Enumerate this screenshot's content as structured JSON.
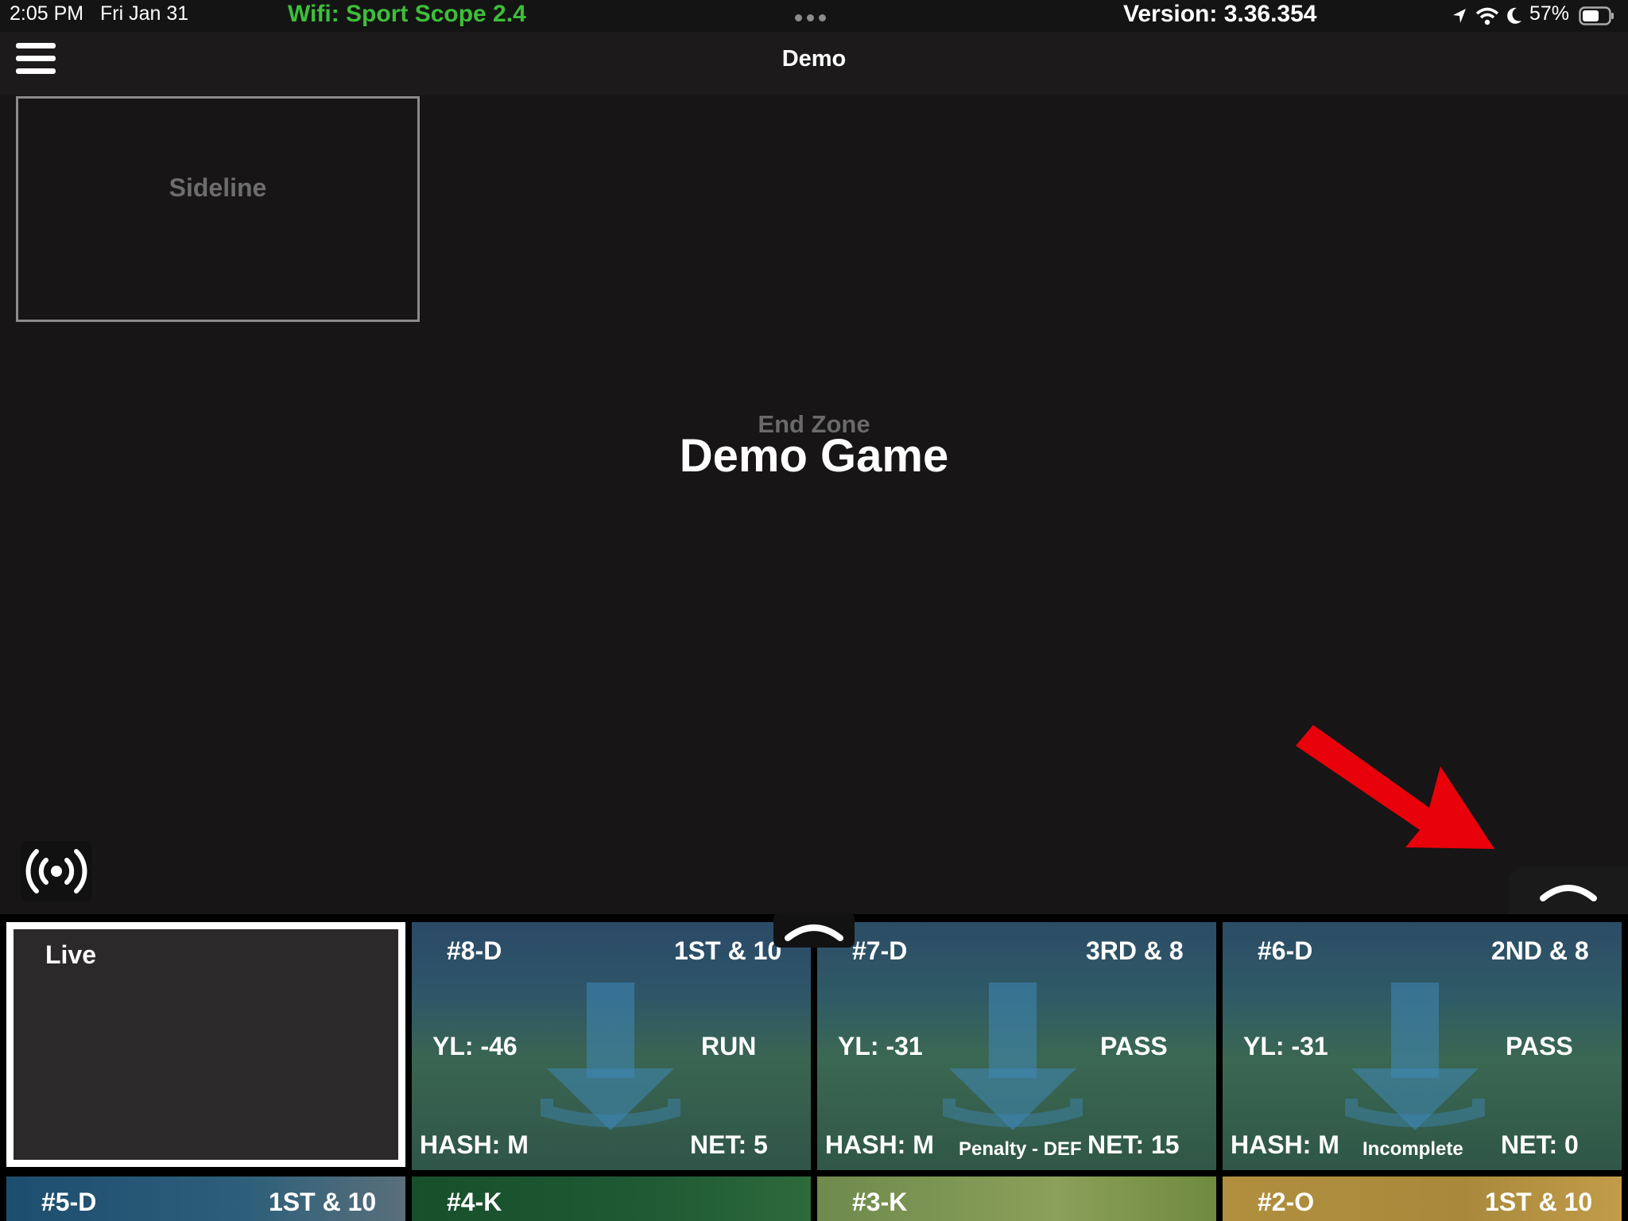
{
  "status_bar": {
    "time": "2:05 PM",
    "date": "Fri Jan 31",
    "wifi_label": "Wifi: Sport Scope 2.4",
    "version": "Version: 3.36.354",
    "battery": "57%",
    "icons": [
      "location-arrow-icon",
      "wifi-icon",
      "moon-icon",
      "battery-icon"
    ]
  },
  "nav": {
    "title": "Demo"
  },
  "main": {
    "camera_angle_1": "Sideline",
    "camera_angle_2": "End Zone",
    "game_title": "Demo Game"
  },
  "live_tile": {
    "label": "Live"
  },
  "clips": [
    {
      "id": "#8-D",
      "down": "1ST & 10",
      "yardline": "YL: -46",
      "play_type": "RUN",
      "hash": "HASH: M",
      "result": "",
      "net": "NET: 5"
    },
    {
      "id": "#7-D",
      "down": "3RD & 8",
      "yardline": "YL: -31",
      "play_type": "PASS",
      "hash": "HASH: M",
      "result": "Penalty - DEF",
      "net": "NET: 15"
    },
    {
      "id": "#6-D",
      "down": "2ND & 8",
      "yardline": "YL: -31",
      "play_type": "PASS",
      "hash": "HASH: M",
      "result": "Incomplete",
      "net": "NET: 0"
    },
    {
      "id": "#5-D",
      "down": "1ST & 10"
    },
    {
      "id": "#4-K",
      "down": ""
    },
    {
      "id": "#3-K",
      "down": ""
    },
    {
      "id": "#2-O",
      "down": "1ST & 10"
    }
  ],
  "colors": {
    "background": "#171516",
    "wifi_green": "#3dbf3a",
    "annotation_red": "#e8000b",
    "clip_defense": "#1a3e4e",
    "clip_kick": "#1f5a35",
    "clip_kick_light": "#6e8a4c",
    "clip_offense": "#a8893c"
  }
}
